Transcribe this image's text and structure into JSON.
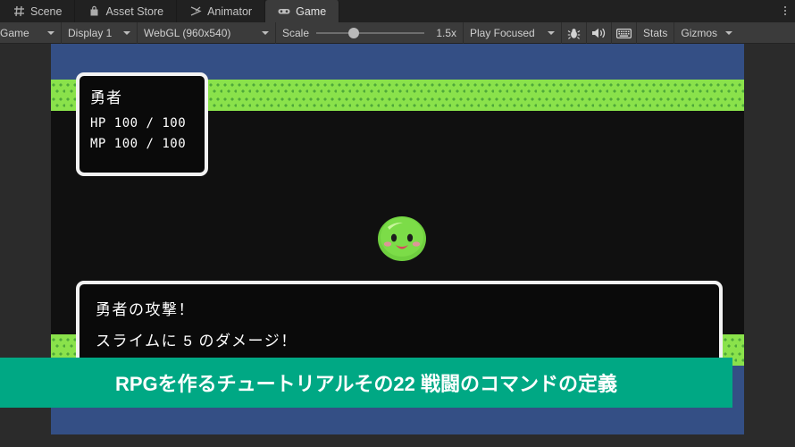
{
  "tabs": [
    {
      "label": "Scene",
      "icon": "grid-icon",
      "active": false
    },
    {
      "label": "Asset Store",
      "icon": "shop-bag-icon",
      "active": false
    },
    {
      "label": "Animator",
      "icon": "animator-icon",
      "active": false
    },
    {
      "label": "Game",
      "icon": "gamepad-icon",
      "active": true
    }
  ],
  "toolbar": {
    "target_display_mode": "Game",
    "display": "Display 1",
    "resolution": "WebGL (960x540)",
    "scale_label": "Scale",
    "scale_value": "1.5x",
    "scale_percent": 30,
    "play_mode": "Play Focused",
    "stats_label": "Stats",
    "gizmos_label": "Gizmos",
    "icons": [
      "bug-icon",
      "mute-audio-icon",
      "stats-grid-icon"
    ]
  },
  "game": {
    "status_window": {
      "name": "勇者",
      "hp_row": "HP  100 / 100",
      "mp_row": "MP  100 / 100"
    },
    "message_window": {
      "line1": "勇者の攻撃！",
      "line2": "スライムに 5 のダメージ！"
    },
    "enemy": {
      "name": "slime-sprite"
    },
    "colors": {
      "sky": "#344f85",
      "grass": "#8ae24b",
      "grass_tuft": "#4fa83a",
      "ground": "#101010",
      "window_border": "#f2f2f2",
      "window_fill": "#0a0a0a",
      "slime_body": "#6fcf3f",
      "slime_highlight": "#b7f08a",
      "slime_cheek": "#f08aa8",
      "slime_mouth": "#d9455c"
    }
  },
  "banner": {
    "text": "RPGを作るチュートリアルその22 戦闘のコマンドの定義",
    "color": "#00a884",
    "text_color": "#ffffff"
  }
}
